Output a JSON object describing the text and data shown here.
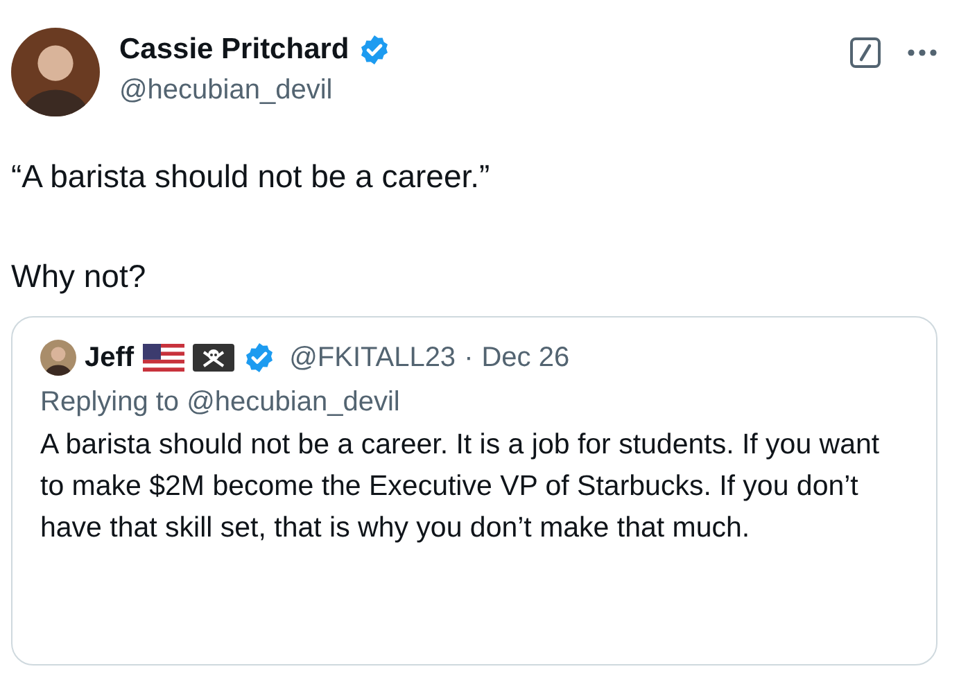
{
  "author": {
    "name": "Cassie Pritchard",
    "verified": true,
    "handle": "@hecubian_devil"
  },
  "tweet": {
    "paragraphs": [
      "“A barista should not be a career.”",
      "Why not?"
    ]
  },
  "quoted_tweet": {
    "name": "Jeff",
    "verified": true,
    "handle": "@FKITALL23",
    "separator": "·",
    "date": "Dec 26",
    "replying_to": "Replying to @hecubian_devil",
    "text": "A barista should not be a career. It is a job for students. If you want to make $2M become the Executive VP of Starbucks. If you don’t have that skill set, that is why you don’t make that much."
  }
}
